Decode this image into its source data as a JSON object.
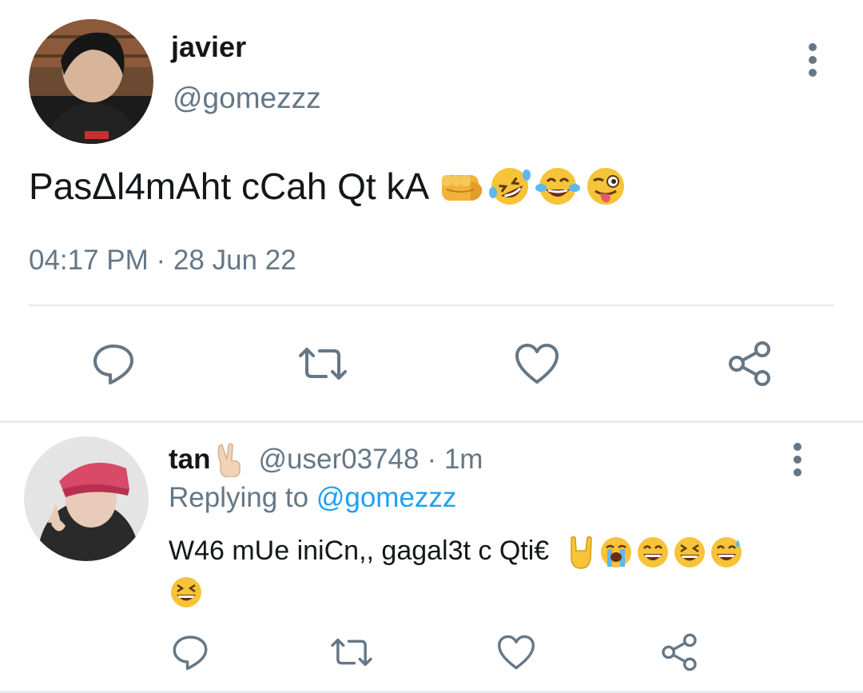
{
  "tweet": {
    "author_name": "javier",
    "author_handle": "@gomezzz",
    "text": "PasΔl4mAht cCah Qt kA",
    "emojis": [
      "fist-emoji",
      "rofl-emoji",
      "tears-of-joy-emoji",
      "winking-tongue-emoji"
    ],
    "timestamp": "04:17 PM · 28 Jun 22"
  },
  "reply": {
    "author_name": "tan",
    "author_emoji": "victory-hand-emoji",
    "author_handle": "@user03748",
    "time": "· 1m",
    "replying_to_label": "Replying to",
    "replying_to_handle": "@gomezzz",
    "text": "W46 mUe iniCn,, gagal3t c Qti€",
    "emojis": [
      "sign-of-horns-emoji",
      "loudly-crying-emoji",
      "grinning-emoji",
      "laughing-emoji",
      "sweat-smile-emoji",
      "laughing-emoji"
    ]
  },
  "colors": {
    "primary_text": "#14171a",
    "secondary_text": "#657786",
    "link": "#1da1f2",
    "divider": "#e1e8ed"
  }
}
